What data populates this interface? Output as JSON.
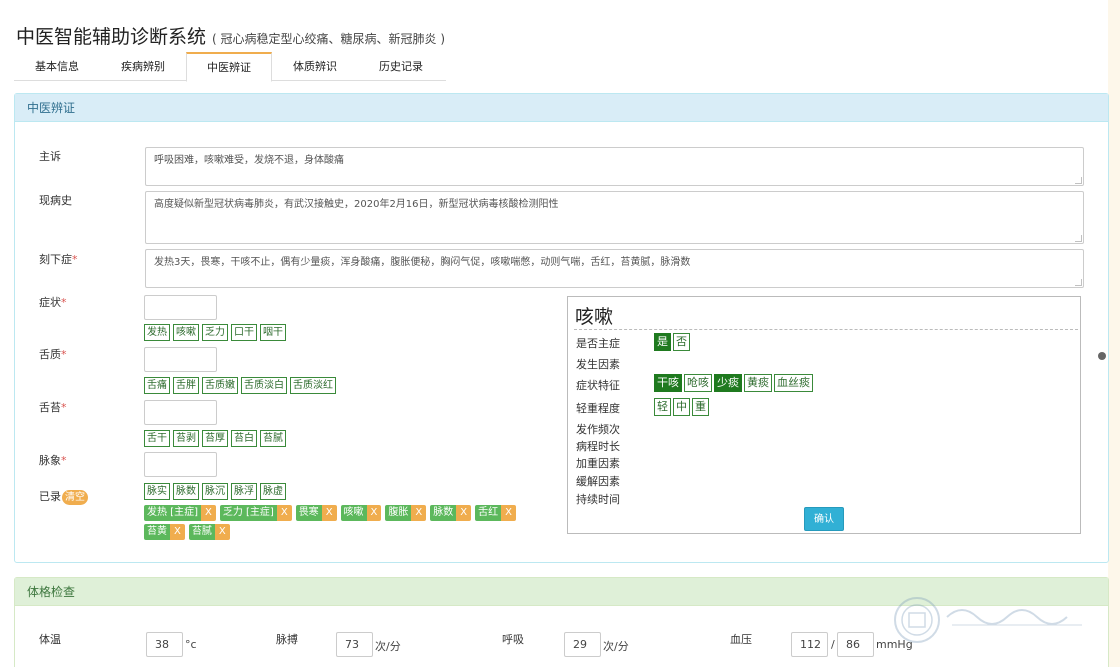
{
  "app": {
    "title": "中医智能辅助诊断系统",
    "subtitle": "( 冠心病稳定型心绞痛、糖尿病、新冠肺炎 )"
  },
  "tabs": [
    "基本信息",
    "疾病辨别",
    "中医辨证",
    "体质辨识",
    "历史记录"
  ],
  "active_tab": "中医辨证",
  "section1": {
    "title": "中医辨证",
    "chief_complaint": {
      "label": "主诉",
      "value": "呼吸困难，咳嗽难受，发烧不退，身体酸痛"
    },
    "present_history": {
      "label": "现病史",
      "value": "高度疑似新型冠状病毒肺炎，有武汉接触史，2020年2月16日，新型冠状病毒核酸检测阳性"
    },
    "current_symptoms": {
      "label": "刻下症",
      "required": "*",
      "value": "发热3天，畏寒，干咳不止，偶有少量痰，浑身酸痛，腹胀便秘，胸闷气促，咳嗽喘憋，动则气喘，舌红，苔黄腻，脉滑数"
    },
    "symptom": {
      "label": "症状",
      "required": "*",
      "chips": [
        "发热",
        "咳嗽",
        "乏力",
        "口干",
        "咽干"
      ]
    },
    "tongue": {
      "label": "舌质",
      "required": "*",
      "chips": [
        "舌痛",
        "舌胖",
        "舌质嫩",
        "舌质淡白",
        "舌质淡红"
      ]
    },
    "coating": {
      "label": "舌苔",
      "required": "*",
      "chips": [
        "舌干",
        "苔剥",
        "苔厚",
        "苔白",
        "苔腻"
      ]
    },
    "pulse": {
      "label": "脉象",
      "required": "*",
      "chips": [
        "脉实",
        "脉数",
        "脉沉",
        "脉浮",
        "脉虚"
      ]
    },
    "recorded": {
      "label": "已录",
      "clear_label": "清空",
      "rows": [
        [
          "发热 [主症]",
          "乏力 [主症]",
          "畏寒",
          "咳嗽",
          "腹胀",
          "脉数",
          "舌红"
        ],
        [
          "苔黄",
          "苔腻"
        ]
      ],
      "remove_label": "X"
    }
  },
  "detail": {
    "title": "咳嗽",
    "rows": [
      {
        "label": "是否主症",
        "options": [
          "是",
          "否"
        ],
        "selected": [
          "是"
        ]
      },
      {
        "label": "发生因素",
        "options": [],
        "selected": []
      },
      {
        "label": "症状特征",
        "options": [
          "干咳",
          "呛咳",
          "少痰",
          "黄痰",
          "血丝痰"
        ],
        "selected": [
          "干咳",
          "少痰"
        ]
      },
      {
        "label": "轻重程度",
        "options": [
          "轻",
          "中",
          "重"
        ],
        "selected": []
      },
      {
        "label": "发作频次",
        "options": [],
        "selected": []
      },
      {
        "label": "病程时长",
        "options": [],
        "selected": []
      },
      {
        "label": "加重因素",
        "options": [],
        "selected": []
      },
      {
        "label": "缓解因素",
        "options": [],
        "selected": []
      },
      {
        "label": "持续时间",
        "options": [],
        "selected": []
      }
    ],
    "confirm_label": "确认"
  },
  "section2": {
    "title": "体格检查",
    "temperature": {
      "label": "体温",
      "value": "38",
      "unit": "°c"
    },
    "pulse_rate": {
      "label": "脉搏",
      "value": "73",
      "unit": "次/分"
    },
    "respiration": {
      "label": "呼吸",
      "value": "29",
      "unit": "次/分"
    },
    "blood_pressure": {
      "label": "血压",
      "systolic": "112",
      "separator": "/",
      "diastolic": "86",
      "unit": "mmHg"
    }
  },
  "colors": {
    "panel_head_blue": "#d9edf7",
    "panel_head_green": "#dff0d8",
    "chip_border": "#3a8a3a",
    "chip_selected": "#1f7a1f",
    "record_tag": "#5cb85c",
    "record_remove": "#f0ad4e",
    "confirm": "#31b0d5",
    "required": "#d9534f"
  }
}
